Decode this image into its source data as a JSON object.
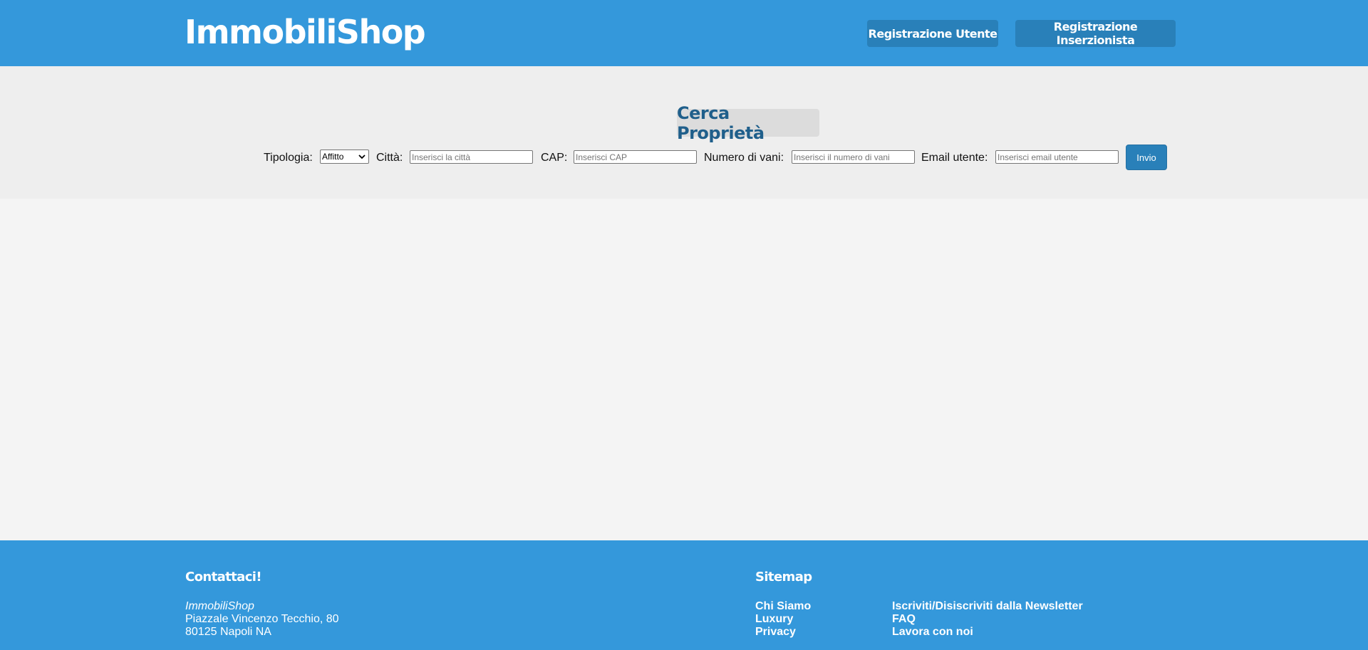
{
  "header": {
    "logo": "ImmobiliShop",
    "buttons": {
      "user_registration": "Registrazione Utente",
      "advertiser_registration": "Registrazione Inserzionista"
    }
  },
  "search": {
    "title": "Cerca Proprietà",
    "type_label": "Tipologia:",
    "type_selected": "Affitto",
    "city_label": "Città:",
    "city_placeholder": "Inserisci la città",
    "cap_label": "CAP:",
    "cap_placeholder": "Inserisci CAP",
    "rooms_label": "Numero di vani:",
    "rooms_placeholder": "Inserisci il numero di vani",
    "email_label": "Email utente:",
    "email_placeholder": "Inserisci email utente",
    "submit_label": "Invio"
  },
  "footer": {
    "contact": {
      "heading": "Contattaci!",
      "company": "ImmobiliShop",
      "address_line1": "Piazzale Vincenzo Tecchio, 80",
      "address_line2": "80125 Napoli NA"
    },
    "sitemap": {
      "heading": "Sitemap",
      "col1": [
        "Chi Siamo",
        "Luxury",
        "Privacy"
      ],
      "col2": [
        "Iscriviti/Disiscriviti dalla Newsletter",
        "FAQ",
        "Lavora con noi"
      ]
    }
  },
  "colors": {
    "primary": "#3498db",
    "button": "#2980b9",
    "title_text": "#1f5f8b",
    "search_bg": "#eeeeee",
    "page_bg": "#f4f4f4"
  },
  "icons": {
    "select_arrow": "chevron-down-icon"
  }
}
